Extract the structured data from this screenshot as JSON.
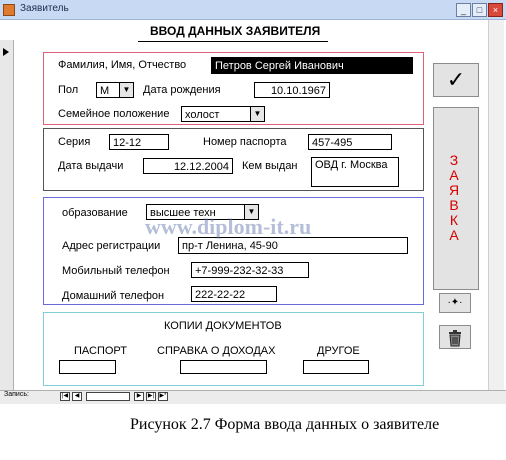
{
  "window": {
    "title": "Заявитель"
  },
  "form": {
    "heading": "ВВОД ДАННЫХ ЗАЯВИТЕЛЯ"
  },
  "personal": {
    "fio_label": "Фамилия, Имя, Отчество",
    "fio_value": "Петров Сергей Иванович",
    "gender_label": "Пол",
    "gender_value": "М",
    "birth_label": "Дата рождения",
    "birth_value": "10.10.1967",
    "marital_label": "Семейное положение",
    "marital_value": "холост"
  },
  "passport": {
    "series_label": "Серия",
    "series_value": "12-12",
    "number_label": "Номер паспорта",
    "number_value": "457-495",
    "issue_date_label": "Дата выдачи",
    "issue_date_value": "12.12.2004",
    "issued_by_label": "Кем выдан",
    "issued_by_value": "ОВД г. Москва"
  },
  "contacts": {
    "education_label": "образование",
    "education_value": "высшее техн",
    "address_label": "Адрес регистрации",
    "address_value": "пр-т Ленина, 45-90",
    "mobile_label": "Мобильный телефон",
    "mobile_value": "+7-999-232-32-33",
    "home_label": "Домашний телефон",
    "home_value": "222-22-22"
  },
  "copies": {
    "title": "КОПИИ ДОКУМЕНТОВ",
    "passport": "ПАСПОРТ",
    "income": "СПРАВКА О ДОХОДАХ",
    "other": "ДРУГОЕ"
  },
  "side_buttons": {
    "confirm_icon": "check-icon",
    "application_letters": [
      "З",
      "А",
      "Я",
      "В",
      "К",
      "А"
    ],
    "add_icon": "add-record-icon",
    "delete_icon": "trash-icon"
  },
  "navigation": {
    "label": "Запись:"
  },
  "watermark": "www.diplom-it.ru",
  "caption": "Рисунок 2.7 Форма ввода данных о заявителе",
  "colors": {
    "personal_border": "#e0607a",
    "passport_border": "#555555",
    "contacts_border": "#6a6ad8",
    "copies_border": "#7fd0d8",
    "application_text": "#d60000"
  }
}
